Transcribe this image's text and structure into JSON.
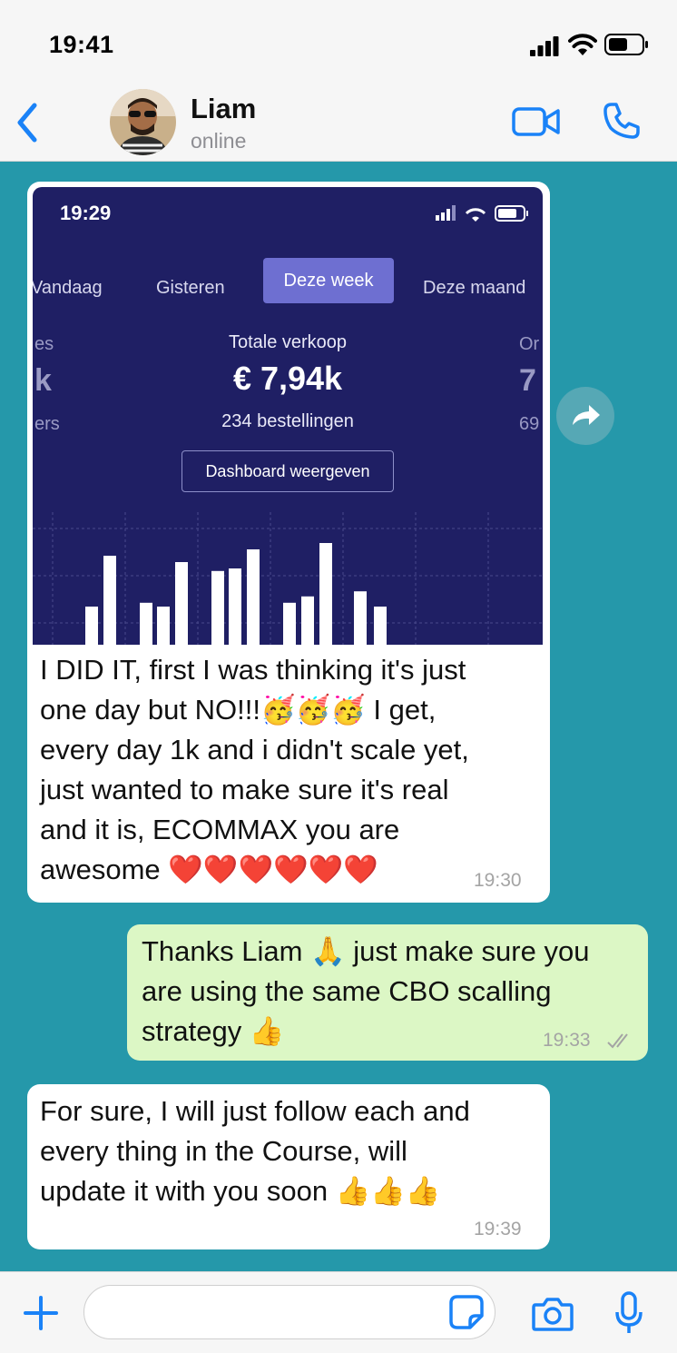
{
  "status_bar": {
    "time": "19:41"
  },
  "header": {
    "contact_name": "Liam",
    "contact_status": "online"
  },
  "messages": [
    {
      "direction": "incoming",
      "screenshot": {
        "time": "19:29",
        "tabs": [
          "Vandaag",
          "Gisteren",
          "Deze week",
          "Deze maand"
        ],
        "active_tab": "Deze week",
        "side_left": {
          "top": "es",
          "mid": "k",
          "bottom": "ers"
        },
        "side_right": {
          "top": "Or",
          "mid": "7",
          "bottom": "69"
        },
        "metric_label": "Totale verkoop",
        "metric_value": "€ 7,94k",
        "metric_sub": "234 bestellingen",
        "button_label": "Dashboard weergeven",
        "bar_heights": [
          0.3,
          0.7,
          0.33,
          0.3,
          0.65,
          0.58,
          0.6,
          0.75,
          0.33,
          0.38,
          0.8,
          0.42,
          0.3
        ]
      },
      "lines": [
        "I DID IT, first I was thinking it's just",
        "one day but NO!!!🥳🥳🥳 I get,",
        "every day 1k and i didn't scale yet,",
        "just wanted to make sure it's real",
        "and it is, ECOMMAX you are",
        "awesome ❤️❤️❤️❤️❤️❤️"
      ],
      "time": "19:30"
    },
    {
      "direction": "outgoing",
      "lines": [
        "Thanks Liam 🙏 just make sure you",
        "are using the same CBO scalling",
        "strategy 👍"
      ],
      "time": "19:33"
    },
    {
      "direction": "incoming",
      "lines": [
        "For sure, I will just follow each and",
        "every thing in the Course, will",
        "update it with you soon 👍👍👍"
      ],
      "time": "19:39"
    }
  ],
  "colors": {
    "accent": "#1a82f7",
    "chat_background": "#2598aa",
    "outgoing_bubble": "#dcf7c5",
    "incoming_bubble": "#ffffff",
    "dashboard_background": "#1f1f64",
    "active_tab": "#6e6fd1"
  },
  "icons": {
    "back": "chevron-left-icon",
    "video": "video-camera-icon",
    "call": "phone-icon",
    "forward": "share-arrow-icon",
    "plus": "plus-icon",
    "sticker": "sticker-icon",
    "camera": "camera-icon",
    "mic": "microphone-icon"
  }
}
